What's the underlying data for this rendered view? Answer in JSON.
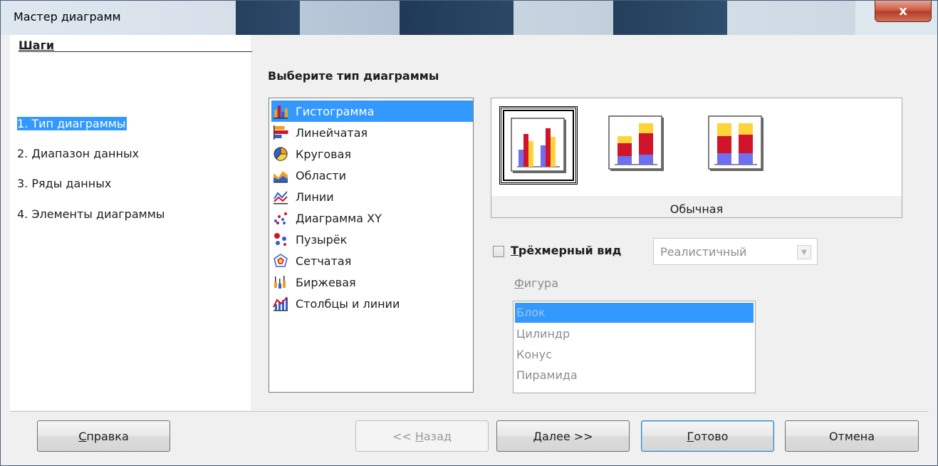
{
  "window": {
    "title": "Мастер диаграмм",
    "close_label": "x"
  },
  "steps": {
    "title": "Шаги",
    "items": [
      {
        "label": "1. Тип диаграммы",
        "active": true
      },
      {
        "label": "2. Диапазон данных",
        "active": false
      },
      {
        "label": "3. Ряды данных",
        "active": false
      },
      {
        "label": "4. Элементы диаграммы",
        "active": false
      }
    ]
  },
  "main": {
    "title": "Выберите тип диаграммы",
    "chart_types": [
      {
        "label": "Гистограмма",
        "icon": "column-chart-icon",
        "selected": true
      },
      {
        "label": "Линейчатая",
        "icon": "bar-chart-icon"
      },
      {
        "label": "Круговая",
        "icon": "pie-chart-icon"
      },
      {
        "label": "Области",
        "icon": "area-chart-icon"
      },
      {
        "label": "Линии",
        "icon": "line-chart-icon"
      },
      {
        "label": "Диаграмма XY",
        "icon": "xy-scatter-icon"
      },
      {
        "label": "Пузырёк",
        "icon": "bubble-chart-icon"
      },
      {
        "label": "Сетчатая",
        "icon": "net-chart-icon"
      },
      {
        "label": "Биржевая",
        "icon": "stock-chart-icon"
      },
      {
        "label": "Столбцы и линии",
        "icon": "column-line-icon"
      }
    ],
    "variant_name": "Обычная",
    "three_d": {
      "label_underlined": "Т",
      "label_rest": "рёхмерный вид",
      "checked": false,
      "style_value": "Реалистичный"
    },
    "shape": {
      "label_underlined": "Ф",
      "label_rest": "игура",
      "items": [
        {
          "label": "Блок",
          "selected": true
        },
        {
          "label": "Цилиндр"
        },
        {
          "label": "Конус"
        },
        {
          "label": "Пирамида"
        }
      ]
    }
  },
  "buttons": {
    "help": {
      "u": "С",
      "rest": "правка"
    },
    "back": {
      "pre": "<< ",
      "u": "Н",
      "rest": "азад"
    },
    "next": {
      "u": "Д",
      "rest": "алее >>"
    },
    "finish": {
      "u": "Г",
      "rest": "отово"
    },
    "cancel": {
      "label": "Отмена"
    }
  },
  "colors": {
    "selection": "#3399ff",
    "bar_blue": "#6f6ff0",
    "bar_red": "#d0142a",
    "bar_yellow": "#ffd43a"
  }
}
